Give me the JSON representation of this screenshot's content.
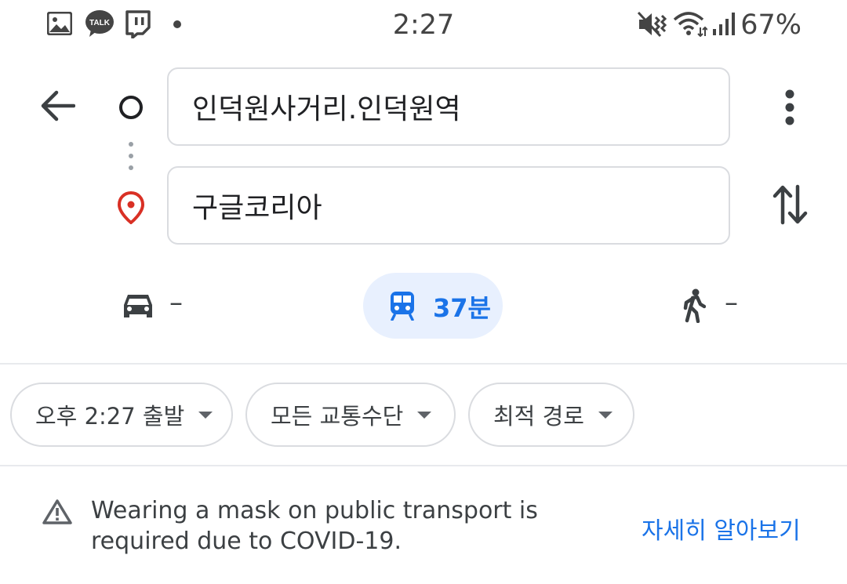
{
  "status_bar": {
    "time": "2:27",
    "battery": "67%",
    "notification_icons": [
      "gallery-icon",
      "kakaotalk-icon",
      "twitch-icon",
      "dot-icon"
    ],
    "kakao_label": "TALK",
    "system_icons": [
      "vibrate-mute-icon",
      "wifi-icon",
      "signal-icon"
    ]
  },
  "directions": {
    "origin": "인덕원사거리.인덕원역",
    "destination": "구글코리아"
  },
  "travel_modes": {
    "car": "–",
    "transit": "37분",
    "walk": "–",
    "selected": "transit",
    "accent_color": "#1a73e8",
    "selected_bg": "#e8f0fe"
  },
  "filters": {
    "depart": "오후 2:27 출발",
    "transit_type": "모든 교통수단",
    "route_pref": "최적 경로"
  },
  "notice": {
    "text": "Wearing a mask on public transport is required due to COVID-19.",
    "link": "자세히 알아보기"
  }
}
